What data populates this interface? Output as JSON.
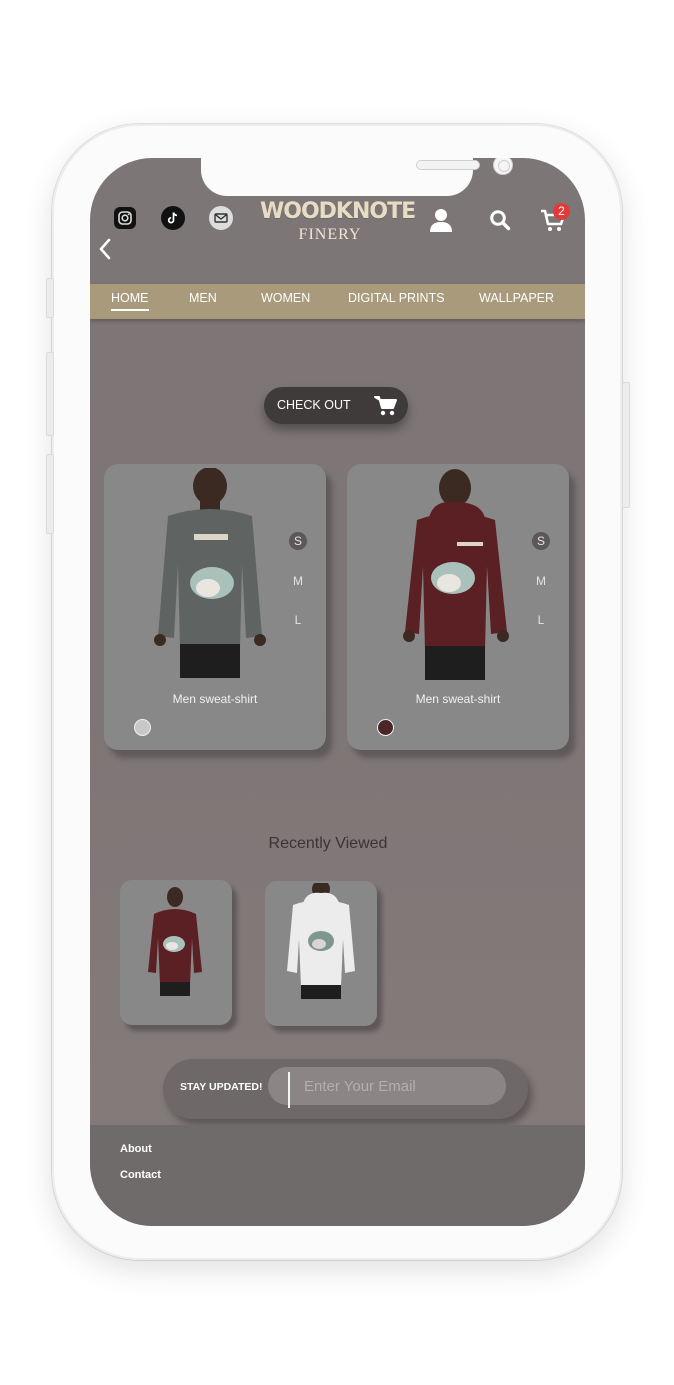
{
  "header": {
    "social_icons": [
      "instagram-icon",
      "tiktok-icon",
      "mail-icon"
    ],
    "logo_main": "WOODKNOTE",
    "logo_sub": "FINERY",
    "account_icon": "user-icon",
    "search_icon": "search-icon",
    "cart_icon": "cart-icon",
    "cart_count": "2",
    "back_icon": "chevron-left-icon"
  },
  "nav": {
    "items": [
      {
        "label": "HOME",
        "active": true
      },
      {
        "label": "MEN"
      },
      {
        "label": "WOMEN"
      },
      {
        "label": "DIGITAL PRINTS"
      },
      {
        "label": "WALLPAPER"
      }
    ]
  },
  "checkout": {
    "label": "CHECK OUT"
  },
  "products": [
    {
      "title": "Men sweat-shirt",
      "sizes": [
        "S",
        "M",
        "L"
      ],
      "selected_size": "S",
      "color": "#c8c8c8",
      "garment_color": "#5f6462"
    },
    {
      "title": "Men sweat-shirt",
      "sizes": [
        "S",
        "M",
        "L"
      ],
      "selected_size": "S",
      "color": "#4a2628",
      "garment_color": "#5a2023"
    }
  ],
  "recently_viewed": {
    "title": "Recently Viewed",
    "items": [
      {
        "garment_color": "#5a2023"
      },
      {
        "garment_color": "#ececec"
      }
    ]
  },
  "newsletter": {
    "label": "STAY UPDATED!",
    "placeholder": "Enter Your Email"
  },
  "footer": {
    "links": [
      "About",
      "Contact"
    ]
  },
  "colors": {
    "screen_bg": "#7d7676",
    "nav_bg": "#a99a7b",
    "card_bg": "#888888",
    "checkout_bg": "#3f3b3a",
    "badge": "#e23a3a"
  }
}
